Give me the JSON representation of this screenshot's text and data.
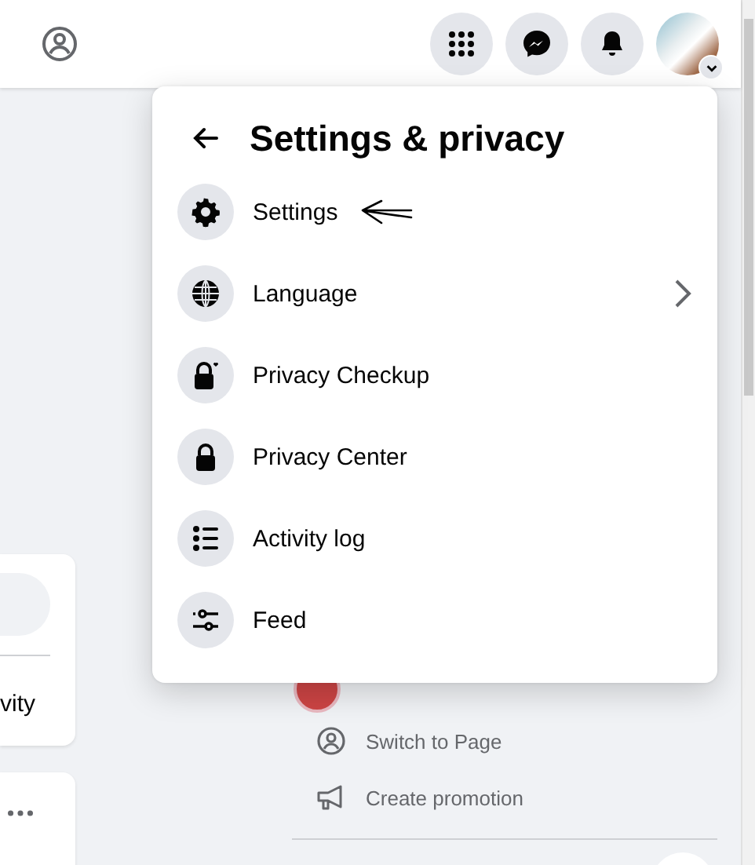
{
  "menu": {
    "title": "Settings & privacy",
    "items": [
      {
        "label": "Settings",
        "has_submenu": false,
        "annotated": true
      },
      {
        "label": "Language",
        "has_submenu": true,
        "annotated": false
      },
      {
        "label": "Privacy Checkup",
        "has_submenu": false,
        "annotated": false
      },
      {
        "label": "Privacy Center",
        "has_submenu": false,
        "annotated": false
      },
      {
        "label": "Activity log",
        "has_submenu": false,
        "annotated": false
      },
      {
        "label": "Feed",
        "has_submenu": false,
        "annotated": false
      }
    ]
  },
  "left_card": {
    "text": "vity"
  },
  "page_actions": [
    {
      "label": "Switch to Page"
    },
    {
      "label": "Create promotion"
    }
  ]
}
